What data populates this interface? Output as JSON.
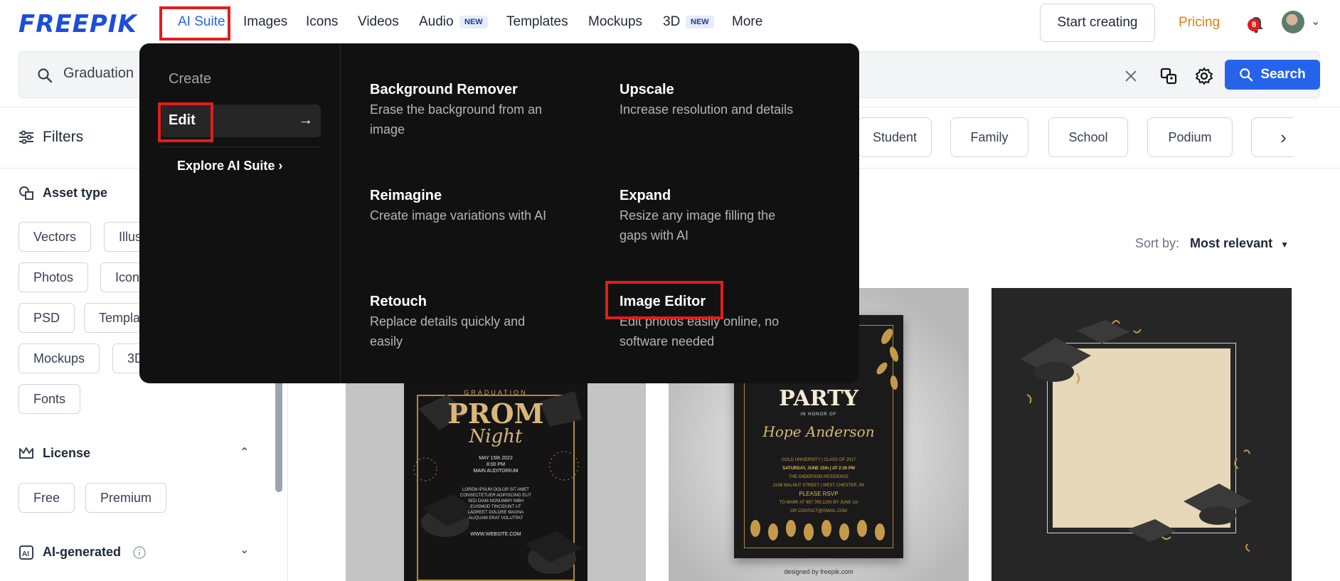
{
  "brand": {
    "logo": "FREEPIK",
    "accent": "#2563eb",
    "pricing_color": "#e17d0e",
    "highlight": "#e11d1d"
  },
  "nav": {
    "items": [
      {
        "label": "AI Suite"
      },
      {
        "label": "Images"
      },
      {
        "label": "Icons"
      },
      {
        "label": "Videos"
      },
      {
        "label": "Audio",
        "badge": "NEW"
      },
      {
        "label": "Templates"
      },
      {
        "label": "Mockups"
      },
      {
        "label": "3D",
        "badge": "NEW"
      },
      {
        "label": "More"
      }
    ],
    "start_creating": "Start creating",
    "pricing": "Pricing",
    "notification_count": "8"
  },
  "search": {
    "query": "Graduation",
    "button_label": "Search"
  },
  "filters": {
    "title": "Filters",
    "chips": [
      "Student",
      "Family",
      "School",
      "Podium"
    ]
  },
  "sidebar": {
    "asset_type": {
      "title": "Asset type",
      "chips": [
        "Vectors",
        "Illus",
        "Photos",
        "Icon",
        "PSD",
        "Templa",
        "Mockups",
        "3D",
        "Fonts"
      ]
    },
    "license": {
      "title": "License",
      "chips": [
        "Free",
        "Premium"
      ]
    },
    "ai_generated": {
      "title": "AI-generated"
    }
  },
  "sort": {
    "label": "Sort by:",
    "value": "Most relevant"
  },
  "cards": [
    {
      "kind": "prom",
      "lines": [
        "GRADUATION",
        "PROM",
        "Night",
        "MAY 15th 2022",
        "8:00 PM",
        "MAIN AUDITORIUM",
        "LOREM IPSUM DOLOR SIT AMET",
        "CONSECTETUER ADIPISCING ELIT",
        "SED DIAM NONUMMY NIBH",
        "EUISMOD TINCIDUNT UT",
        "LAOREET DOLORE MAGNA",
        "ALIQUAM ERAT VOLUTPAT",
        "WWW.WEBSITE.COM"
      ]
    },
    {
      "kind": "party",
      "lines": [
        "PARTY",
        "IN HONOR OF",
        "Hope Anderson",
        "GOLD UNIVERSITY | CLASS OF 2017",
        "SATURDAY, JUNE 15th | AT 2:30 PM",
        "THE ANDERSON RESIDENCE",
        "2198 WALNUT STREET | WEST CHESTER, PA",
        "PLEASE RSVP",
        "TO MARK AT 987.765.1230 BY JUNE 1st",
        "OR CONTACT@GMAIL.COM",
        "designed by freepik.com"
      ]
    },
    {
      "kind": "frame"
    }
  ],
  "dropdown": {
    "create": "Create",
    "edit": "Edit",
    "edit_arrow": "→",
    "explore": "Explore AI Suite",
    "explore_chevron": "›",
    "tools": [
      {
        "title": "Background Remover",
        "desc": "Erase the background from an image"
      },
      {
        "title": "Upscale",
        "desc": "Increase resolution and details"
      },
      {
        "title": "Reimagine",
        "desc": "Create image variations with AI"
      },
      {
        "title": "Expand",
        "desc": "Resize any image filling the gaps with AI"
      },
      {
        "title": "Retouch",
        "desc": "Replace details quickly and easily"
      },
      {
        "title": "Image Editor",
        "desc": "Edit photos easily online, no software needed"
      }
    ]
  }
}
